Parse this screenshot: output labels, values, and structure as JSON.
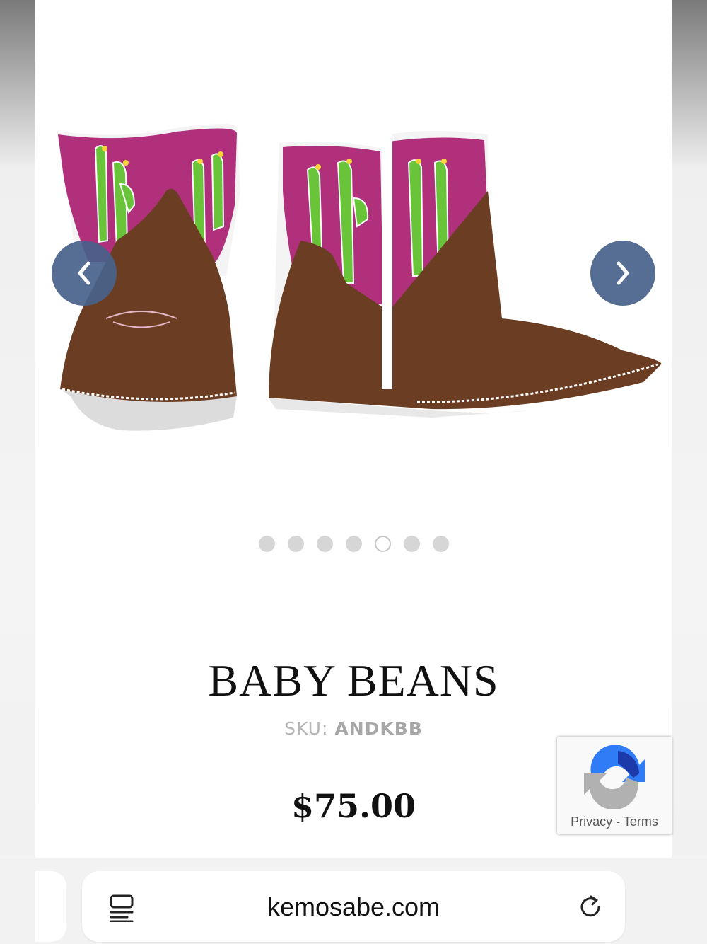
{
  "product": {
    "title": "BABY BEANS",
    "sku_label": "SKU:",
    "sku_value": "ANDKBB",
    "price": "$75.00",
    "image_icon": "cactus-baby-boots-image"
  },
  "carousel": {
    "prev_icon": "chevron-left-icon",
    "next_icon": "chevron-right-icon",
    "slide_count": 7,
    "active_index": 4
  },
  "recaptcha": {
    "privacy": "Privacy",
    "separator": "-",
    "terms": "Terms"
  },
  "browser": {
    "url": "kemosabe.com",
    "reader_icon": "reader-mode-icon",
    "reload_icon": "reload-icon"
  },
  "colors": {
    "arrow_bg": "#48628a",
    "boot_leather": "#6b3d22",
    "boot_shaft": "#b0307c",
    "cactus": "#6ac43a"
  }
}
